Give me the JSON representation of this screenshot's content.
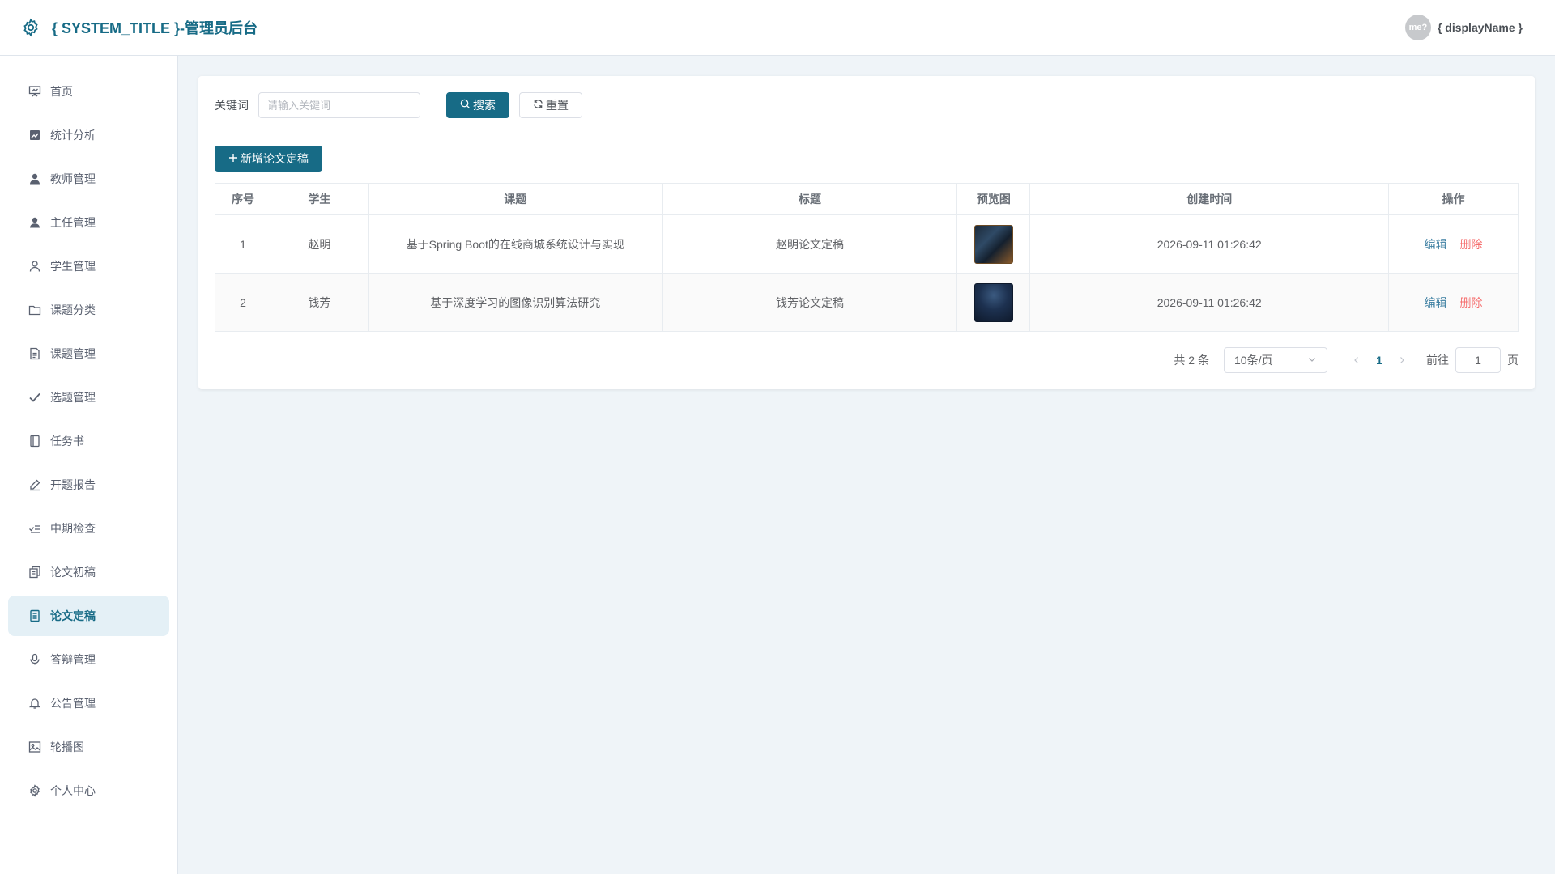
{
  "header": {
    "title": "{ SYSTEM_TITLE }-管理员后台",
    "avatar_text": "me?",
    "display_name": "{ displayName }"
  },
  "sidebar": {
    "items": [
      {
        "label": "首页",
        "icon": "presentation-icon"
      },
      {
        "label": "统计分析",
        "icon": "chart-icon"
      },
      {
        "label": "教师管理",
        "icon": "user-filled-icon"
      },
      {
        "label": "主任管理",
        "icon": "user-filled-icon"
      },
      {
        "label": "学生管理",
        "icon": "user-outline-icon"
      },
      {
        "label": "课题分类",
        "icon": "folder-icon"
      },
      {
        "label": "课题管理",
        "icon": "document-icon"
      },
      {
        "label": "选题管理",
        "icon": "check-icon"
      },
      {
        "label": "任务书",
        "icon": "notebook-icon"
      },
      {
        "label": "开题报告",
        "icon": "edit-pen-icon"
      },
      {
        "label": "中期检查",
        "icon": "checklist-icon"
      },
      {
        "label": "论文初稿",
        "icon": "copy-document-icon"
      },
      {
        "label": "论文定稿",
        "icon": "tickets-icon"
      },
      {
        "label": "答辩管理",
        "icon": "microphone-icon"
      },
      {
        "label": "公告管理",
        "icon": "bell-icon"
      },
      {
        "label": "轮播图",
        "icon": "picture-icon"
      },
      {
        "label": "个人中心",
        "icon": "gear-icon"
      }
    ],
    "active_index": 12
  },
  "search": {
    "label": "关键词",
    "placeholder": "请输入关键词",
    "search_button": "搜索",
    "reset_button": "重置"
  },
  "add_button": "新增论文定稿",
  "table": {
    "columns": [
      "序号",
      "学生",
      "课题",
      "标题",
      "预览图",
      "创建时间",
      "操作"
    ],
    "rows": [
      {
        "index": "1",
        "student": "赵明",
        "topic": "基于Spring Boot的在线商城系统设计与实现",
        "title": "赵明论文定稿",
        "created": "2026-09-11 01:26:42",
        "edit": "编辑",
        "delete": "删除"
      },
      {
        "index": "2",
        "student": "钱芳",
        "topic": "基于深度学习的图像识别算法研究",
        "title": "钱芳论文定稿",
        "created": "2026-09-11 01:26:42",
        "edit": "编辑",
        "delete": "删除"
      }
    ]
  },
  "pagination": {
    "total": "共 2 条",
    "page_size": "10条/页",
    "current_page": "1",
    "goto_label": "前往",
    "goto_value": "1",
    "goto_suffix": "页"
  },
  "colors": {
    "primary": "#176b86",
    "danger": "#f56c6c",
    "link": "#3b7ea1",
    "background": "#eff4f8"
  }
}
